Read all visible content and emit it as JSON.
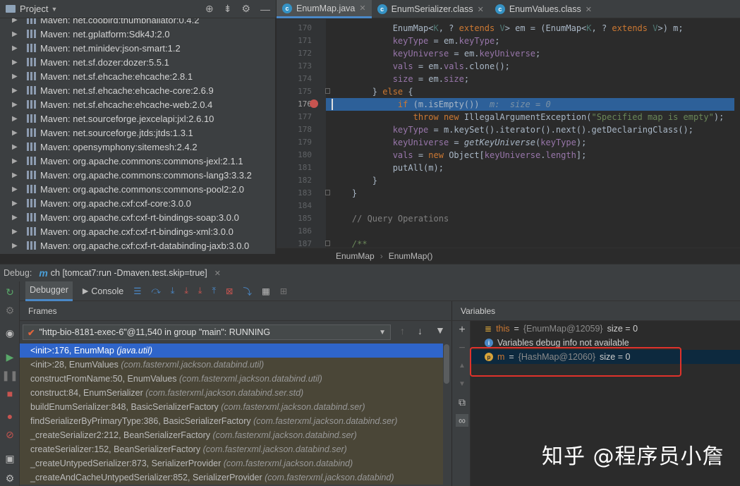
{
  "project": {
    "title": "Project",
    "items": [
      "Maven: net.coobird:thumbnailator:0.4.2",
      "Maven: net.gplatform:Sdk4J:2.0",
      "Maven: net.minidev:json-smart:1.2",
      "Maven: net.sf.dozer:dozer:5.5.1",
      "Maven: net.sf.ehcache:ehcache:2.8.1",
      "Maven: net.sf.ehcache:ehcache-core:2.6.9",
      "Maven: net.sf.ehcache:ehcache-web:2.0.4",
      "Maven: net.sourceforge.jexcelapi:jxl:2.6.10",
      "Maven: net.sourceforge.jtds:jtds:1.3.1",
      "Maven: opensymphony:sitemesh:2.4.2",
      "Maven: org.apache.commons:commons-jexl:2.1.1",
      "Maven: org.apache.commons:commons-lang3:3.3.2",
      "Maven: org.apache.commons:commons-pool2:2.0",
      "Maven: org.apache.cxf:cxf-core:3.0.0",
      "Maven: org.apache.cxf:cxf-rt-bindings-soap:3.0.0",
      "Maven: org.apache.cxf:cxf-rt-bindings-xml:3.0.0",
      "Maven: org.apache.cxf:cxf-rt-databinding-jaxb:3.0.0"
    ]
  },
  "editor": {
    "tabs": [
      "EnumMap.java",
      "EnumSerializer.class",
      "EnumValues.class"
    ],
    "line_numbers": [
      "170",
      "171",
      "172",
      "173",
      "174",
      "175",
      "176",
      "177",
      "178",
      "179",
      "180",
      "181",
      "182",
      "183",
      "184",
      "185",
      "186",
      "187"
    ],
    "current_line": "176",
    "inline_debug": "m:  size = 0",
    "breadcrumb": [
      "EnumMap",
      "EnumMap()"
    ]
  },
  "debug": {
    "label": "Debug:",
    "session": "ch [tomcat7:run -Dmaven.test.skip=true]",
    "tabs": [
      "Debugger",
      "Console"
    ],
    "frames_title": "Frames",
    "thread": "\"http-bio-8181-exec-6\"@11,540 in group \"main\": RUNNING",
    "frames": [
      {
        "m": "<init>:176, EnumMap",
        "p": "(java.util)"
      },
      {
        "m": "<init>:28, EnumValues",
        "p": "(com.fasterxml.jackson.databind.util)"
      },
      {
        "m": "constructFromName:50, EnumValues",
        "p": "(com.fasterxml.jackson.databind.util)"
      },
      {
        "m": "construct:84, EnumSerializer",
        "p": "(com.fasterxml.jackson.databind.ser.std)"
      },
      {
        "m": "buildEnumSerializer:848, BasicSerializerFactory",
        "p": "(com.fasterxml.jackson.databind.ser)"
      },
      {
        "m": "findSerializerByPrimaryType:386, BasicSerializerFactory",
        "p": "(com.fasterxml.jackson.databind.ser)"
      },
      {
        "m": "_createSerializer2:212, BeanSerializerFactory",
        "p": "(com.fasterxml.jackson.databind.ser)"
      },
      {
        "m": "createSerializer:152, BeanSerializerFactory",
        "p": "(com.fasterxml.jackson.databind.ser)"
      },
      {
        "m": "_createUntypedSerializer:873, SerializerProvider",
        "p": "(com.fasterxml.jackson.databind)"
      },
      {
        "m": "_createAndCacheUntypedSerializer:852, SerializerProvider",
        "p": "(com.fasterxml.jackson.databind)"
      }
    ],
    "variables_title": "Variables",
    "variables": [
      {
        "name": "this",
        "ref": "{EnumMap@12059}",
        "size": "size = 0"
      },
      {
        "info": "Variables debug info not available"
      },
      {
        "name": "m",
        "ref": "{HashMap@12060}",
        "size": "size = 0"
      }
    ]
  },
  "watermark": "知乎 @程序员小詹"
}
